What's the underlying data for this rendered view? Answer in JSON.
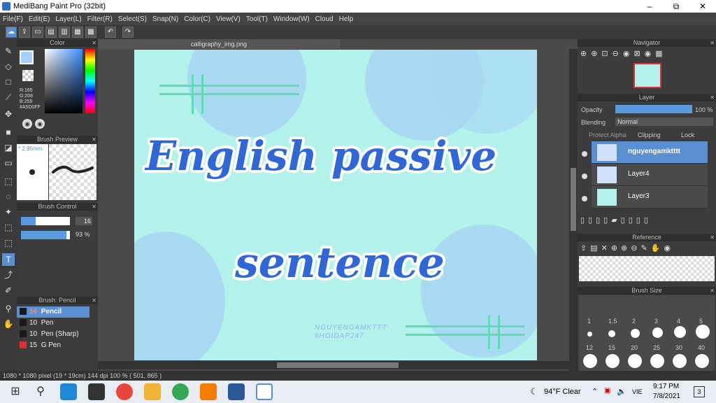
{
  "window": {
    "title": "MediBang Paint Pro (32bit)",
    "min": "–",
    "restore": "⧉",
    "close": "✕"
  },
  "menu": [
    "File(F)",
    "Edit(E)",
    "Layer(L)",
    "Filter(R)",
    "Select(S)",
    "Snap(N)",
    "Color(C)",
    "View(V)",
    "Tool(T)",
    "Window(W)",
    "Cloud",
    "Help"
  ],
  "panels": {
    "color": {
      "title": "Color",
      "r": "R:165",
      "g": "G:208",
      "b": "B:255",
      "hex": "#A5D0FF",
      "fg": "#a5d0ff"
    },
    "brush_preview": {
      "title": "Brush Preview",
      "size": "* 2.95mm"
    },
    "brush_control": {
      "title": "Brush Control",
      "size": "16",
      "opacity": "93 %"
    },
    "brush_list": {
      "title": "Brush: Pencil",
      "items": [
        {
          "size": "16",
          "name": "Pencil",
          "color": "#1a1a1a"
        },
        {
          "size": "10",
          "name": "Pen",
          "color": "#1a1a1a"
        },
        {
          "size": "10",
          "name": "Pen (Sharp)",
          "color": "#1a1a1a"
        },
        {
          "size": "15",
          "name": "G Pen",
          "color": "#e03030"
        }
      ]
    },
    "navigator": {
      "title": "Navigator"
    },
    "layer": {
      "title": "Layer",
      "opacity_label": "Opacity",
      "opacity_value": "100 %",
      "blending_label": "Blending",
      "blending_value": "Normal",
      "protect_alpha": "Protect Alpha",
      "clipping": "Clipping",
      "lock": "Lock",
      "layers": [
        "nguyengamktttt",
        "Layer4",
        "Layer3"
      ]
    },
    "reference": {
      "title": "Reference"
    },
    "brush_size": {
      "title": "Brush Size",
      "row1": [
        "1",
        "1.5",
        "2",
        "3",
        "4",
        "5"
      ],
      "row2": [
        "12",
        "15",
        "20",
        "25",
        "30",
        "40"
      ]
    }
  },
  "canvas": {
    "tab": "calligraphy_img.png",
    "line1": "English passive",
    "line2": "sentence",
    "wm1": "NGUYENGAMKTTT",
    "wm2": "#HOIDAP247"
  },
  "status": "1080 * 1080 pixel  (19 * 19cm)  144 dpi  100 %  ( 501, 865 )",
  "taskbar": {
    "weather": "94°F Clear",
    "lang": "VIE",
    "time": "9:17 PM",
    "date": "7/8/2021",
    "notif": "3"
  }
}
